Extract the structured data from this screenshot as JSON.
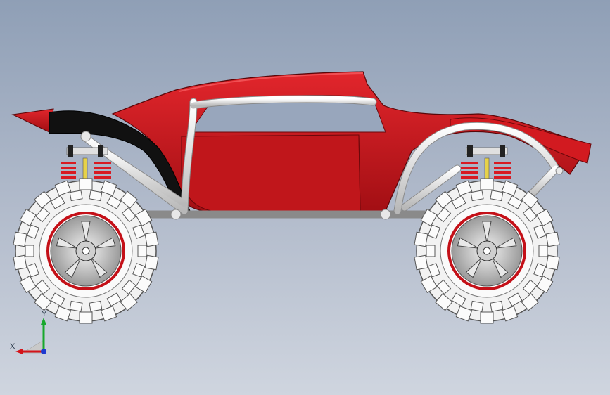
{
  "viewport": {
    "background_top": "#8f9fb6",
    "background_bottom": "#cfd5df"
  },
  "model": {
    "body_color": "#c8161c",
    "body_dark": "#8e0c10",
    "fender_color": "#111111",
    "frame_color": "#e6e6e6",
    "tire_color": "#f2f2f2",
    "spring_color": "#d81a22",
    "rim_color": "#c41018"
  },
  "triad": {
    "x_label": "X",
    "y_label": "Y",
    "x_color": "#d4141a",
    "y_color": "#18a82c",
    "z_color": "#1e3ad0"
  }
}
